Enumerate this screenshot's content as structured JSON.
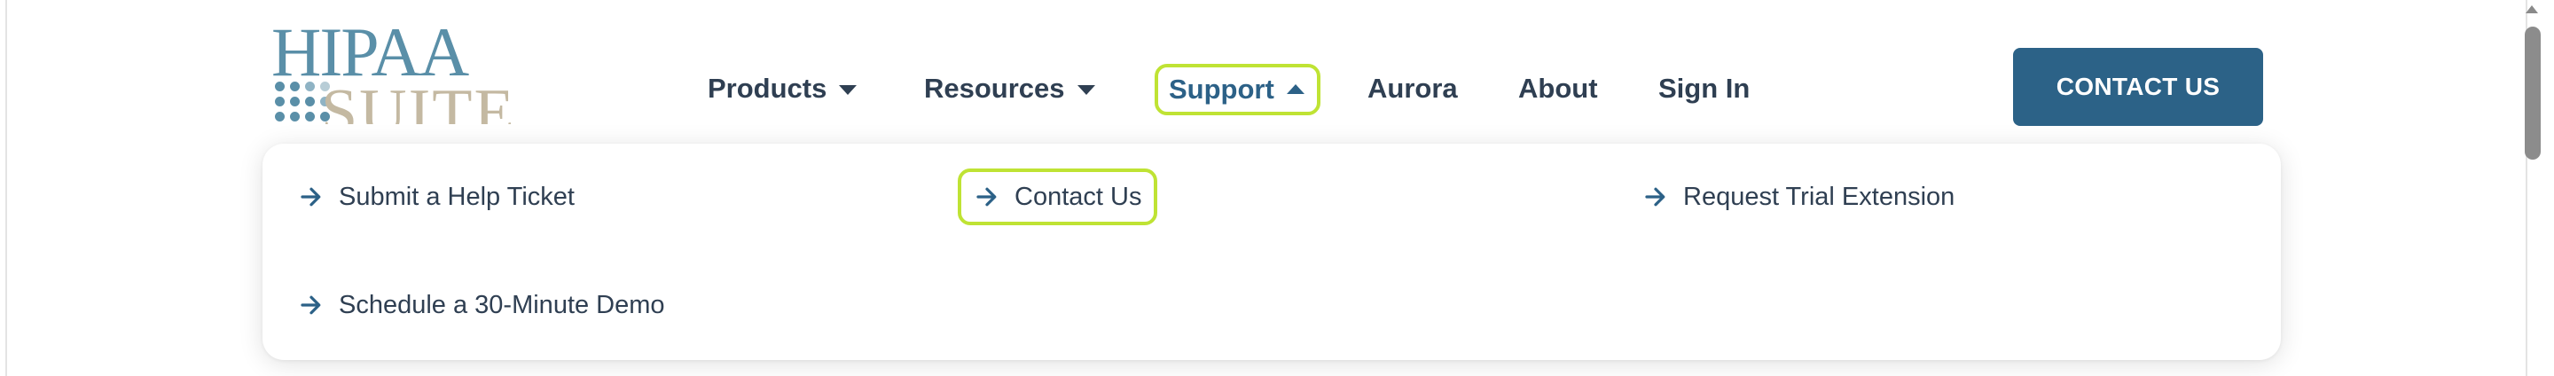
{
  "logo": {
    "line1": "HIPAA",
    "line2": "SUITE",
    "colors": {
      "primary": "#5a8fa8",
      "secondary": "#c4b9a2"
    }
  },
  "nav": {
    "items": [
      {
        "label": "Products",
        "has_caret": true,
        "expanded": false
      },
      {
        "label": "Resources",
        "has_caret": true,
        "expanded": false
      },
      {
        "label": "Support",
        "has_caret": true,
        "expanded": true
      },
      {
        "label": "Aurora",
        "has_caret": false
      },
      {
        "label": "About",
        "has_caret": false
      },
      {
        "label": "Sign In",
        "has_caret": false
      }
    ]
  },
  "cta": {
    "label": "CONTACT US",
    "color": "#2c6287"
  },
  "dropdown": {
    "links": [
      {
        "label": "Submit a Help Ticket",
        "icon": "arrow-right-icon"
      },
      {
        "label": "Contact Us",
        "icon": "arrow-right-icon",
        "highlighted": true
      },
      {
        "label": "Request Trial Extension",
        "icon": "arrow-right-icon"
      },
      {
        "label": "Schedule a 30-Minute Demo",
        "icon": "arrow-right-icon"
      }
    ]
  },
  "theme": {
    "text": "#2f3f52",
    "accent": "#2c6187",
    "highlight": "#bfe334"
  }
}
